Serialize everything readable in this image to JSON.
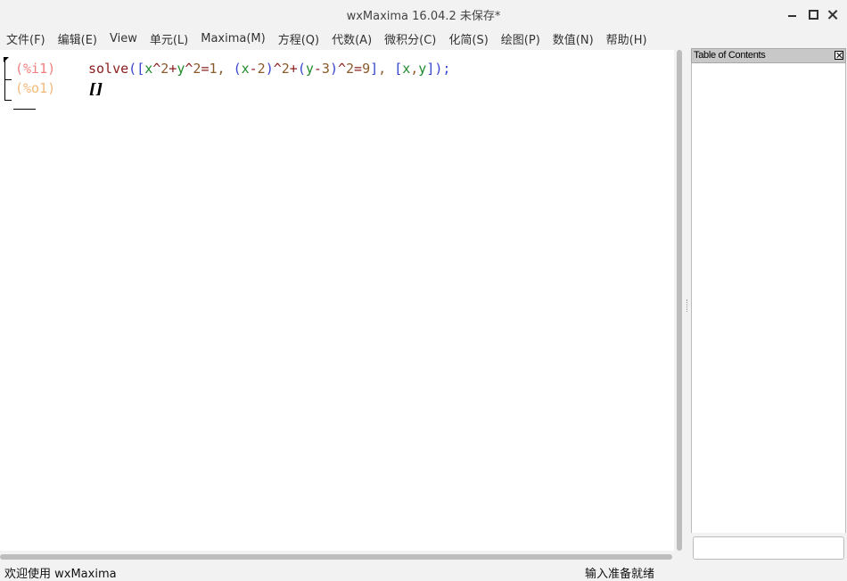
{
  "window": {
    "title": "wxMaxima 16.04.2 未保存*"
  },
  "menu": {
    "items": [
      {
        "label": "文件(F)",
        "name": "menu-file"
      },
      {
        "label": "编辑(E)",
        "name": "menu-edit"
      },
      {
        "label": "View",
        "name": "menu-view"
      },
      {
        "label": "单元(L)",
        "name": "menu-cell"
      },
      {
        "label": "Maxima(M)",
        "name": "menu-maxima"
      },
      {
        "label": "方程(Q)",
        "name": "menu-equations"
      },
      {
        "label": "代数(A)",
        "name": "menu-algebra"
      },
      {
        "label": "微积分(C)",
        "name": "menu-calculus"
      },
      {
        "label": "化简(S)",
        "name": "menu-simplify"
      },
      {
        "label": "绘图(P)",
        "name": "menu-plot"
      },
      {
        "label": "数值(N)",
        "name": "menu-numeric"
      },
      {
        "label": "帮助(H)",
        "name": "menu-help"
      }
    ]
  },
  "worksheet": {
    "input_label": "(%i1)",
    "output_label": "(%o1)",
    "input_code": "solve([x^2+y^2=1, (x-2)^2+(y-3)^2=9], [x,y]);",
    "output_value": "[]"
  },
  "toc": {
    "title": "Table of Contents",
    "search_value": ""
  },
  "status": {
    "left": "欢迎使用 wxMaxima",
    "right": "输入准备就绪"
  },
  "icons": {
    "minimize": "minimize-icon",
    "maximize": "maximize-icon",
    "close": "close-icon",
    "toc_close": "close-icon"
  }
}
